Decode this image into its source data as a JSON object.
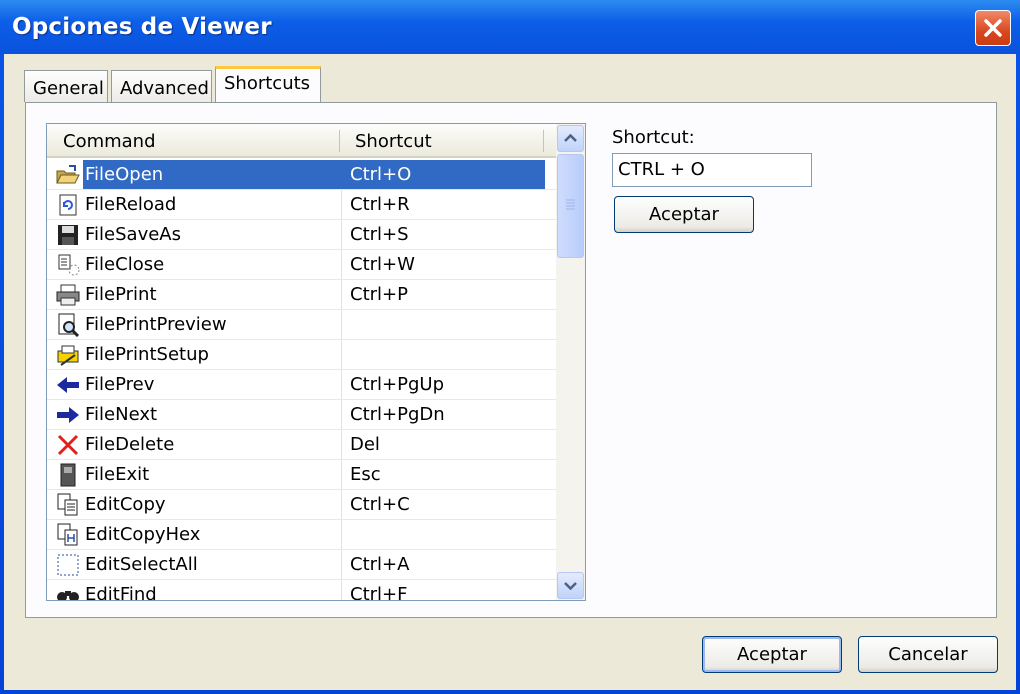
{
  "window": {
    "title": "Opciones de Viewer",
    "close_icon": "close-icon"
  },
  "tabs": [
    {
      "label": "General",
      "active": false
    },
    {
      "label": "Advanced",
      "active": false
    },
    {
      "label": "Shortcuts",
      "active": true
    }
  ],
  "list": {
    "headers": {
      "command": "Command",
      "shortcut": "Shortcut"
    },
    "rows": [
      {
        "command": "FileOpen",
        "shortcut": "Ctrl+O",
        "icon": "folder-open-icon",
        "selected": true
      },
      {
        "command": "FileReload",
        "shortcut": "Ctrl+R",
        "icon": "reload-icon"
      },
      {
        "command": "FileSaveAs",
        "shortcut": "Ctrl+S",
        "icon": "floppy-icon"
      },
      {
        "command": "FileClose",
        "shortcut": "Ctrl+W",
        "icon": "close-file-icon"
      },
      {
        "command": "FilePrint",
        "shortcut": "Ctrl+P",
        "icon": "printer-icon"
      },
      {
        "command": "FilePrintPreview",
        "shortcut": "",
        "icon": "print-preview-icon"
      },
      {
        "command": "FilePrintSetup",
        "shortcut": "",
        "icon": "print-setup-icon"
      },
      {
        "command": "FilePrev",
        "shortcut": "Ctrl+PgUp",
        "icon": "arrow-left-icon"
      },
      {
        "command": "FileNext",
        "shortcut": "Ctrl+PgDn",
        "icon": "arrow-right-icon"
      },
      {
        "command": "FileDelete",
        "shortcut": "Del",
        "icon": "delete-x-icon"
      },
      {
        "command": "FileExit",
        "shortcut": "Esc",
        "icon": "exit-door-icon"
      },
      {
        "command": "EditCopy",
        "shortcut": "Ctrl+C",
        "icon": "copy-icon"
      },
      {
        "command": "EditCopyHex",
        "shortcut": "",
        "icon": "copy-hex-icon"
      },
      {
        "command": "EditSelectAll",
        "shortcut": "Ctrl+A",
        "icon": "select-all-icon"
      },
      {
        "command": "EditFind",
        "shortcut": "Ctrl+F",
        "icon": "binoculars-icon"
      }
    ]
  },
  "shortcut_editor": {
    "label": "Shortcut:",
    "value": "CTRL + O",
    "accept_label": "Aceptar"
  },
  "footer": {
    "ok_label": "Aceptar",
    "cancel_label": "Cancelar"
  },
  "colors": {
    "selection": "#316ac5",
    "titlebar": "#0a52dc",
    "tab_highlight": "#ffc73c"
  }
}
